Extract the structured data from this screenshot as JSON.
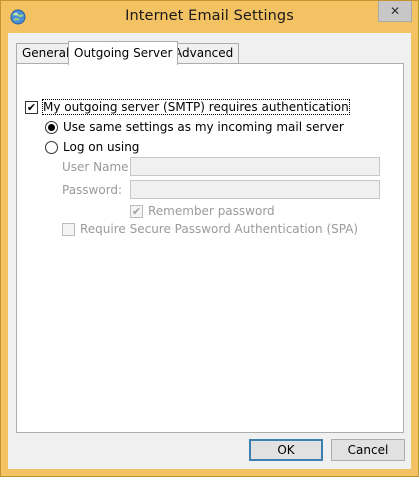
{
  "window": {
    "title": "Internet Email Settings",
    "close_symbol": "✕",
    "app_icon": "outlook-globe-icon"
  },
  "tabs": [
    {
      "label": "General",
      "selected": false
    },
    {
      "label": "Outgoing Server",
      "selected": true
    },
    {
      "label": "Advanced",
      "selected": false
    }
  ],
  "outgoing": {
    "smtp_auth": {
      "label": "My outgoing server (SMTP) requires authentication",
      "checked": true
    },
    "use_same": {
      "label": "Use same settings as my incoming mail server",
      "selected": true
    },
    "log_on": {
      "label": "Log on using",
      "selected": false
    },
    "user_name": {
      "label": "User Name:",
      "value": ""
    },
    "password": {
      "label": "Password:",
      "value": ""
    },
    "remember": {
      "label": "Remember password",
      "checked": true,
      "enabled": false
    },
    "spa": {
      "label": "Require Secure Password Authentication (SPA)",
      "checked": false,
      "enabled": false
    }
  },
  "buttons": {
    "ok": "OK",
    "cancel": "Cancel"
  },
  "colors": {
    "titlebar": "#f3c262",
    "default_button_border": "#3c7fb1"
  }
}
